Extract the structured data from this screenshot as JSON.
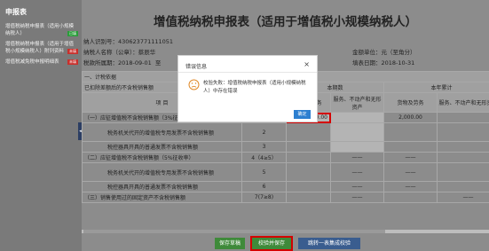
{
  "sidebar": {
    "title": "申报表",
    "items": [
      {
        "label": "增值税纳税申报表（适用小规模纳税人）",
        "badge": "已填",
        "badge_color": "#2a9d3a"
      },
      {
        "label": "增值税纳税申报表（适用于增值税小规模纳税人）附列资料",
        "badge": "未填",
        "badge_color": "#c9302c"
      },
      {
        "label": "增值税减免税申报明细表",
        "badge": "未填",
        "badge_color": "#c9302c"
      }
    ]
  },
  "header": {
    "title": "增值税纳税申报表（适用于增值税小规模纳税人）",
    "taxpayer_id_label": "纳人识别号：",
    "taxpayer_id": "430623771111051",
    "taxpayer_name_label": "纳税人名称（公章）：",
    "taxpayer_name": "蔡辰华",
    "period_label": "税款所属期：",
    "period_start": "2018-09-01",
    "period_to": "至",
    "amount_unit_label": "金额单位：",
    "amount_unit": "元（至角分）",
    "fill_date_label": "填表日期：",
    "fill_date": "2018-10-31"
  },
  "table": {
    "section_label": "一、计税依据",
    "section_sub": "已扣除差额后的不含税销售额",
    "project_header": "项 目",
    "current_period": "本期数",
    "year_total": "本年累计",
    "goods_services": "货物及劳务",
    "intangible": "服务、不动产和无形资产",
    "rows": [
      {
        "label": "（一）应征增值税不含税销售额（3%征收率）",
        "line": "1",
        "current_goods": "2,000.00",
        "current_service": "",
        "year_goods": "2,000.00",
        "year_service": ""
      },
      {
        "label": "税务机关代开的增值税专用发票不含税销售额",
        "line": "2",
        "current_goods": "",
        "current_service": "",
        "year_goods": "",
        "year_service": ""
      },
      {
        "label": "税控器具开具的普通发票不含税销售额",
        "line": "3",
        "current_goods": "",
        "current_service": "",
        "year_goods": "",
        "year_service": ""
      },
      {
        "label": "（二）应征增值税不含税销售额（5%征收率）",
        "line": "4（4≥5）",
        "current_goods": "",
        "current_service": "——",
        "year_goods": "——",
        "year_service": ""
      },
      {
        "label": "税务机关代开的增值税专用发票不含税销售额",
        "line": "5",
        "current_goods": "",
        "current_service": "——",
        "year_goods": "——",
        "year_service": ""
      },
      {
        "label": "税控器具开具的普通发票不含税销售额",
        "line": "6",
        "current_goods": "",
        "current_service": "——",
        "year_goods": "——",
        "year_service": ""
      },
      {
        "label": "（三）销售使用过的固定资产不含税销售额",
        "line": "7(7≥8)",
        "current_goods": "",
        "current_service": "——",
        "year_goods": "",
        "year_service": "——"
      }
    ]
  },
  "buttons": {
    "save": "保存草稿",
    "validate_save": "校验并保存",
    "goto_next": "跳转一表集成校验"
  },
  "modal": {
    "title": "错误信息",
    "close": "×",
    "message": "校验失败：增值税纳税申报表（适用小规模纳税人）中存在错误",
    "ok": "确定",
    "icon": "sad-face-icon"
  }
}
